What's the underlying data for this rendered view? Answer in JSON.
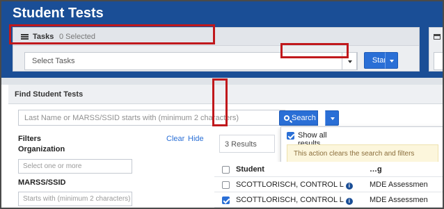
{
  "header": {
    "title": "Student Tests"
  },
  "tasks": {
    "label": "Tasks",
    "selected_count": "0 Selected",
    "select_placeholder": "Select Tasks",
    "start_label": "Start"
  },
  "find": {
    "title": "Find Student Tests",
    "search_placeholder": "Last Name or MARSS/SSID starts with (minimum 2 characters)",
    "search_label": "Search",
    "dropdown": {
      "show_all_label": "Show all results",
      "show_all_checked": true,
      "warning": "This action clears the search and filters"
    }
  },
  "filters": {
    "title": "Filters",
    "clear_label": "Clear",
    "hide_label": "Hide",
    "organization_label": "Organization",
    "organization_placeholder": "Select one or more",
    "marss_label": "MARSS/SSID",
    "marss_placeholder": "Starts with (minimum 2 characters)"
  },
  "results": {
    "count_text": "3 Results",
    "columns": [
      "Student",
      "…g"
    ],
    "rows": [
      {
        "student": "SCOTTLORISCH, CONTROL L",
        "test": "MDE Assessmen",
        "checked": false
      },
      {
        "student": "SCOTTLORISCH, CONTROL L",
        "test": "MDE Assessmen",
        "checked": true
      }
    ]
  },
  "icons": {
    "tasks": "list-icon",
    "search": "magnifier-icon",
    "info": "info-icon"
  },
  "colors": {
    "header_blue": "#1a4e96",
    "button_blue": "#2a6fd6",
    "highlight_red": "#c0181c",
    "warning_bg": "#fcf6dc"
  }
}
